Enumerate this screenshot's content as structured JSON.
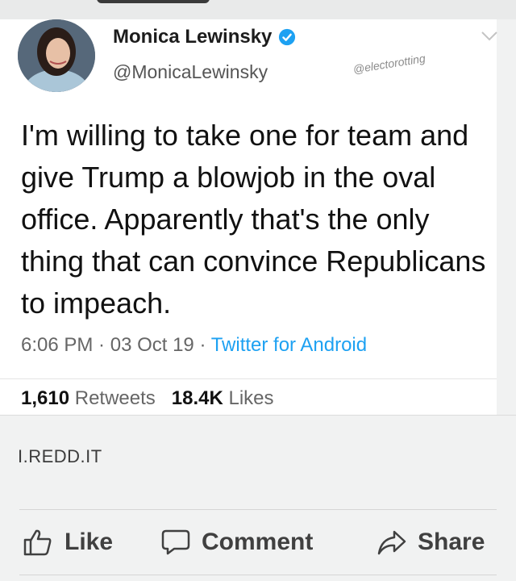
{
  "tweet": {
    "author_name": "Monica Lewinsky",
    "handle": "@MonicaLewinsky",
    "watermark": "@electorotting",
    "text": "I'm willing to take one for team and give Trump a blowjob in the oval office. Apparently that's the only thing that can convince Republicans to impeach.",
    "time": "6:06 PM",
    "sep1": " · ",
    "date": "03 Oct 19",
    "sep2": " · ",
    "source": "Twitter for Android",
    "retweets_count": "1,610",
    "retweets_label": "Retweets",
    "likes_count": "18.4K",
    "likes_label": "Likes"
  },
  "link_preview": {
    "domain": "I.REDD.IT"
  },
  "actions": {
    "like_label": "Like",
    "comment_label": "Comment",
    "share_label": "Share"
  },
  "colors": {
    "verified": "#1da1f2",
    "source_link": "#1da1f2",
    "action_text": "#404040"
  },
  "icons": [
    "verified-icon",
    "chevron-down-icon",
    "thumbs-up-icon",
    "comment-icon",
    "share-icon"
  ]
}
